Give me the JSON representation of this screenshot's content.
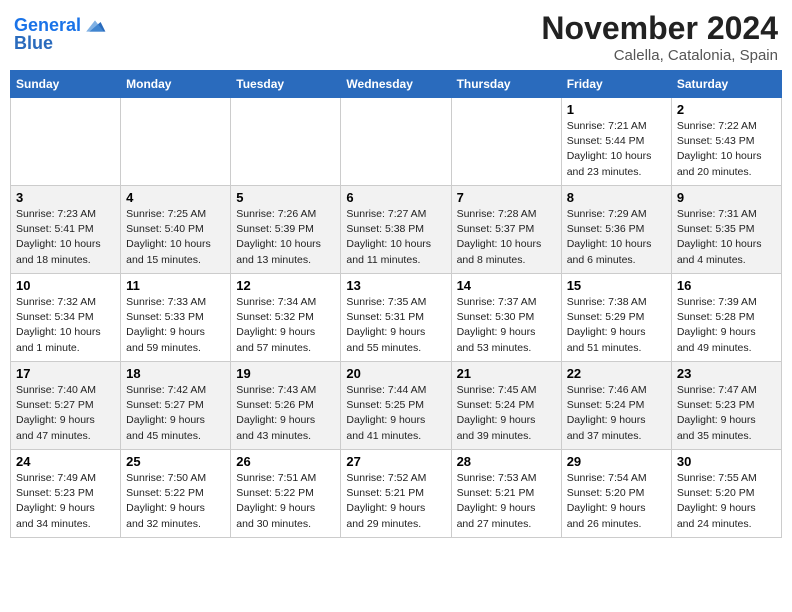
{
  "header": {
    "logo_line1": "General",
    "logo_line2": "Blue",
    "month": "November 2024",
    "location": "Calella, Catalonia, Spain"
  },
  "weekdays": [
    "Sunday",
    "Monday",
    "Tuesday",
    "Wednesday",
    "Thursday",
    "Friday",
    "Saturday"
  ],
  "weeks": [
    [
      {
        "day": "",
        "info": ""
      },
      {
        "day": "",
        "info": ""
      },
      {
        "day": "",
        "info": ""
      },
      {
        "day": "",
        "info": ""
      },
      {
        "day": "",
        "info": ""
      },
      {
        "day": "1",
        "info": "Sunrise: 7:21 AM\nSunset: 5:44 PM\nDaylight: 10 hours and 23 minutes."
      },
      {
        "day": "2",
        "info": "Sunrise: 7:22 AM\nSunset: 5:43 PM\nDaylight: 10 hours and 20 minutes."
      }
    ],
    [
      {
        "day": "3",
        "info": "Sunrise: 7:23 AM\nSunset: 5:41 PM\nDaylight: 10 hours and 18 minutes."
      },
      {
        "day": "4",
        "info": "Sunrise: 7:25 AM\nSunset: 5:40 PM\nDaylight: 10 hours and 15 minutes."
      },
      {
        "day": "5",
        "info": "Sunrise: 7:26 AM\nSunset: 5:39 PM\nDaylight: 10 hours and 13 minutes."
      },
      {
        "day": "6",
        "info": "Sunrise: 7:27 AM\nSunset: 5:38 PM\nDaylight: 10 hours and 11 minutes."
      },
      {
        "day": "7",
        "info": "Sunrise: 7:28 AM\nSunset: 5:37 PM\nDaylight: 10 hours and 8 minutes."
      },
      {
        "day": "8",
        "info": "Sunrise: 7:29 AM\nSunset: 5:36 PM\nDaylight: 10 hours and 6 minutes."
      },
      {
        "day": "9",
        "info": "Sunrise: 7:31 AM\nSunset: 5:35 PM\nDaylight: 10 hours and 4 minutes."
      }
    ],
    [
      {
        "day": "10",
        "info": "Sunrise: 7:32 AM\nSunset: 5:34 PM\nDaylight: 10 hours and 1 minute."
      },
      {
        "day": "11",
        "info": "Sunrise: 7:33 AM\nSunset: 5:33 PM\nDaylight: 9 hours and 59 minutes."
      },
      {
        "day": "12",
        "info": "Sunrise: 7:34 AM\nSunset: 5:32 PM\nDaylight: 9 hours and 57 minutes."
      },
      {
        "day": "13",
        "info": "Sunrise: 7:35 AM\nSunset: 5:31 PM\nDaylight: 9 hours and 55 minutes."
      },
      {
        "day": "14",
        "info": "Sunrise: 7:37 AM\nSunset: 5:30 PM\nDaylight: 9 hours and 53 minutes."
      },
      {
        "day": "15",
        "info": "Sunrise: 7:38 AM\nSunset: 5:29 PM\nDaylight: 9 hours and 51 minutes."
      },
      {
        "day": "16",
        "info": "Sunrise: 7:39 AM\nSunset: 5:28 PM\nDaylight: 9 hours and 49 minutes."
      }
    ],
    [
      {
        "day": "17",
        "info": "Sunrise: 7:40 AM\nSunset: 5:27 PM\nDaylight: 9 hours and 47 minutes."
      },
      {
        "day": "18",
        "info": "Sunrise: 7:42 AM\nSunset: 5:27 PM\nDaylight: 9 hours and 45 minutes."
      },
      {
        "day": "19",
        "info": "Sunrise: 7:43 AM\nSunset: 5:26 PM\nDaylight: 9 hours and 43 minutes."
      },
      {
        "day": "20",
        "info": "Sunrise: 7:44 AM\nSunset: 5:25 PM\nDaylight: 9 hours and 41 minutes."
      },
      {
        "day": "21",
        "info": "Sunrise: 7:45 AM\nSunset: 5:24 PM\nDaylight: 9 hours and 39 minutes."
      },
      {
        "day": "22",
        "info": "Sunrise: 7:46 AM\nSunset: 5:24 PM\nDaylight: 9 hours and 37 minutes."
      },
      {
        "day": "23",
        "info": "Sunrise: 7:47 AM\nSunset: 5:23 PM\nDaylight: 9 hours and 35 minutes."
      }
    ],
    [
      {
        "day": "24",
        "info": "Sunrise: 7:49 AM\nSunset: 5:23 PM\nDaylight: 9 hours and 34 minutes."
      },
      {
        "day": "25",
        "info": "Sunrise: 7:50 AM\nSunset: 5:22 PM\nDaylight: 9 hours and 32 minutes."
      },
      {
        "day": "26",
        "info": "Sunrise: 7:51 AM\nSunset: 5:22 PM\nDaylight: 9 hours and 30 minutes."
      },
      {
        "day": "27",
        "info": "Sunrise: 7:52 AM\nSunset: 5:21 PM\nDaylight: 9 hours and 29 minutes."
      },
      {
        "day": "28",
        "info": "Sunrise: 7:53 AM\nSunset: 5:21 PM\nDaylight: 9 hours and 27 minutes."
      },
      {
        "day": "29",
        "info": "Sunrise: 7:54 AM\nSunset: 5:20 PM\nDaylight: 9 hours and 26 minutes."
      },
      {
        "day": "30",
        "info": "Sunrise: 7:55 AM\nSunset: 5:20 PM\nDaylight: 9 hours and 24 minutes."
      }
    ]
  ]
}
